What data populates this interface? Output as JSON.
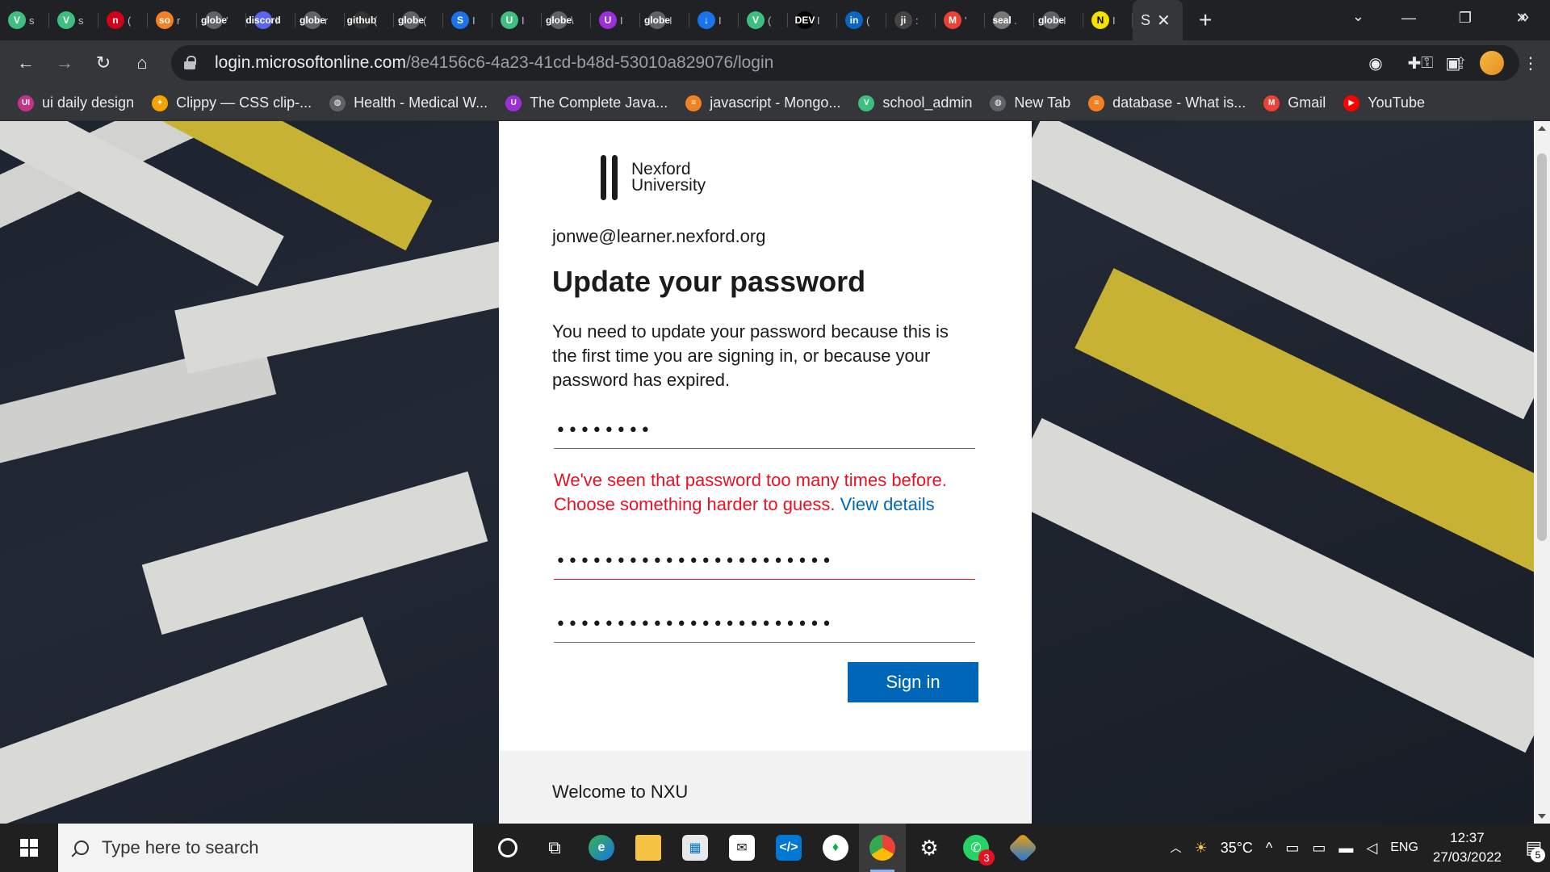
{
  "tabs": [
    {
      "favicon": "V",
      "color": "#3fbf7f",
      "text": "s"
    },
    {
      "favicon": "V",
      "color": "#3fbf7f",
      "text": "s"
    },
    {
      "favicon": "n",
      "color": "#d0021b",
      "text": "("
    },
    {
      "favicon": "so",
      "color": "#f48024",
      "text": "r"
    },
    {
      "favicon": "globe",
      "color": "#5f6368",
      "text": "'"
    },
    {
      "favicon": "discord",
      "color": "#5865f2",
      "text": "I"
    },
    {
      "favicon": "globe",
      "color": "#5f6368",
      "text": "r"
    },
    {
      "favicon": "github",
      "color": "#333333",
      "text": "("
    },
    {
      "favicon": "globe",
      "color": "#5f6368",
      "text": "("
    },
    {
      "favicon": "S",
      "color": "#1a73e8",
      "text": "I"
    },
    {
      "favicon": "U",
      "color": "#3fbf7f",
      "text": "I"
    },
    {
      "favicon": "globe",
      "color": "#5f6368",
      "text": "\\"
    },
    {
      "favicon": "U",
      "color": "#9b30d9",
      "text": "I"
    },
    {
      "favicon": "globe",
      "color": "#5f6368",
      "text": "I"
    },
    {
      "favicon": "↓",
      "color": "#1a73e8",
      "text": "I"
    },
    {
      "favicon": "V",
      "color": "#3fbf7f",
      "text": "("
    },
    {
      "favicon": "DEV",
      "color": "#000000",
      "text": "I"
    },
    {
      "favicon": "in",
      "color": "#0a66c2",
      "text": "("
    },
    {
      "favicon": "ji",
      "color": "#444444",
      "text": ":"
    },
    {
      "favicon": "M",
      "color": "#ea4335",
      "text": "'"
    },
    {
      "favicon": "seal",
      "color": "#777777",
      "text": "."
    },
    {
      "favicon": "globe",
      "color": "#5f6368",
      "text": "I"
    },
    {
      "favicon": "N",
      "color": "#f5e000",
      "text": "I"
    }
  ],
  "active_tab": {
    "text": "S",
    "close": "✕"
  },
  "new_tab": "+",
  "window_controls": {
    "minimize": "—",
    "restore": "❐",
    "close": "✕",
    "tab_search": "⌄"
  },
  "toolbar": {
    "back": "←",
    "forward": "→",
    "reload": "↻",
    "home": "⌂",
    "url_host": "login.microsoftonline.com",
    "url_path": "/8e4156c6-4a23-41cd-b48d-53010a829076/login"
  },
  "bookmarks": [
    {
      "label": "ui daily design",
      "favicon": "UI",
      "color": "#c13584"
    },
    {
      "label": "Clippy — CSS clip-...",
      "favicon": "✦",
      "color": "#f4a300"
    },
    {
      "label": "Health - Medical W...",
      "favicon": "◍",
      "color": "#5f6368"
    },
    {
      "label": "The Complete Java...",
      "favicon": "U",
      "color": "#9b30d9"
    },
    {
      "label": "javascript - Mongo...",
      "favicon": "≡",
      "color": "#f48024"
    },
    {
      "label": "school_admin",
      "favicon": "V",
      "color": "#3fbf7f"
    },
    {
      "label": "New Tab",
      "favicon": "◍",
      "color": "#5f6368"
    },
    {
      "label": "database - What is...",
      "favicon": "≡",
      "color": "#f48024"
    },
    {
      "label": "Gmail",
      "favicon": "M",
      "color": "#ea4335"
    },
    {
      "label": "YouTube",
      "favicon": "▶",
      "color": "#ff0000"
    }
  ],
  "bookmarks_more": "»",
  "login": {
    "logo_line1": "Nexford",
    "logo_line2": "University",
    "email": "jonwe@learner.nexford.org",
    "heading": "Update your password",
    "description": "You need to update your password because this is the first time you are signing in, or because your password has expired.",
    "current_password": "••••••••",
    "error_text": "We've seen that password too many times before. Choose something harder to guess.",
    "error_link": "View details",
    "new_password": "•••••••••••••••••••••••",
    "confirm_password": "•••••••••••••••••••••••",
    "signin_label": "Sign in",
    "welcome": "Welcome to NXU"
  },
  "taskbar": {
    "search_placeholder": "Type here to search",
    "whatsapp_badge": "3",
    "weather": "35°C",
    "language": "ENG",
    "time": "12:37",
    "date": "27/03/2022",
    "notifications": "5"
  },
  "colors": {
    "accent": "#0067b8",
    "error": "#e81123"
  }
}
